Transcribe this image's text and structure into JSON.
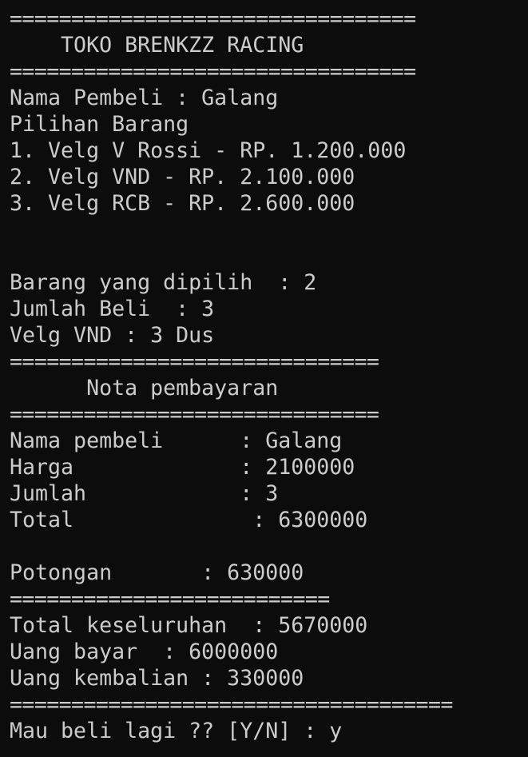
{
  "terminal": {
    "lines": [
      "=================================",
      "    TOKO BRENKZZ RACING",
      "=================================",
      "Nama Pembeli : Galang",
      "Pilihan Barang",
      "1. Velg V Rossi - RP. 1.200.000",
      "2. Velg VND - RP. 2.100.000",
      "3. Velg RCB - RP. 2.600.000",
      "",
      "",
      "Barang yang dipilih  : 2",
      "Jumlah Beli  : 3",
      "Velg VND : 3 Dus",
      "==============================",
      "      Nota pembayaran",
      "==============================",
      "Nama pembeli      : Galang",
      "Harga             : 2100000",
      "Jumlah            : 3",
      "Total              : 6300000",
      "",
      "Potongan       : 630000",
      "==========================",
      "Total keseluruhan  : 5670000",
      "Uang bayar  : 6000000",
      "Uang kembalian : 330000",
      "====================================",
      "Mau beli lagi ?? [Y/N] : y"
    ]
  }
}
